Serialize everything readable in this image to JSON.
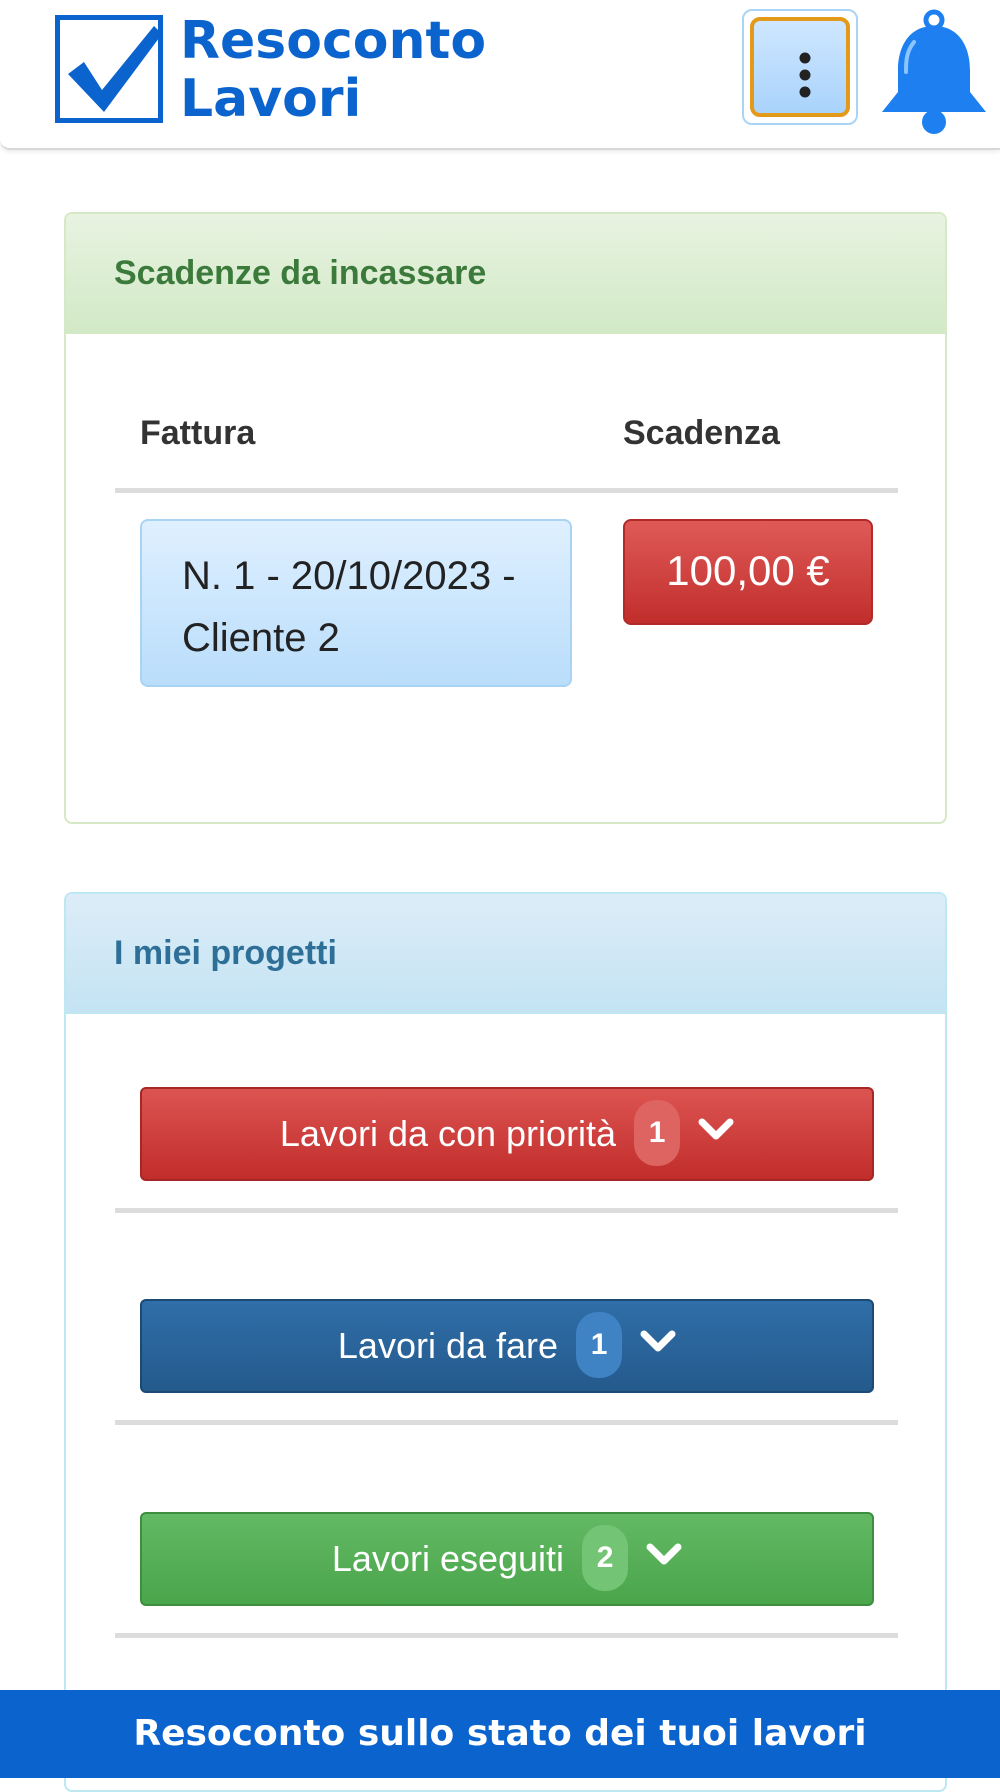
{
  "header": {
    "title_line1": "Resoconto",
    "title_line2": "Lavori",
    "menu_icon": "kebab-menu-icon",
    "bell_icon": "bell-icon"
  },
  "colors": {
    "brand": "#0b63ce",
    "danger": "#c9302c",
    "primary": "#286090",
    "success": "#5cb85c"
  },
  "scadenze": {
    "title": "Scadenze da incassare",
    "columns": [
      "Fattura",
      "Scadenza"
    ],
    "rows": [
      {
        "fattura": "N. 1 - 20/10/2023 - Cliente 2",
        "importo": "100,00 €"
      }
    ]
  },
  "progetti": {
    "title": "I miei progetti",
    "groups": [
      {
        "label": "Lavori da con priorità",
        "count": "1",
        "color": "#c9302c"
      },
      {
        "label": "Lavori da fare",
        "count": "1",
        "color": "#286090"
      },
      {
        "label": "Lavori eseguiti",
        "count": "2",
        "color": "#5cb85c"
      }
    ]
  },
  "footer": {
    "text": "Resoconto sullo stato dei tuoi lavori"
  }
}
